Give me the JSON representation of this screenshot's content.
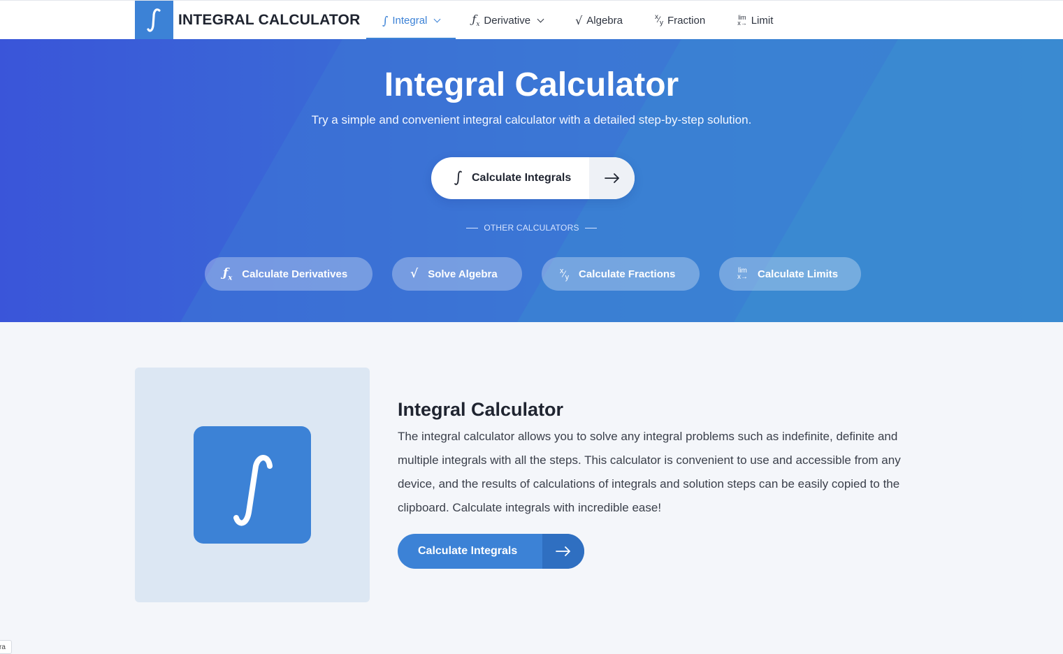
{
  "header": {
    "logo_text": "INTEGRAL CALCULATOR",
    "nav": [
      {
        "label": "Integral",
        "icon": "integral-icon",
        "glyph": "∫",
        "active": true,
        "dropdown": true
      },
      {
        "label": "Derivative",
        "icon": "function-icon",
        "glyph": "ƒ",
        "active": false,
        "dropdown": true
      },
      {
        "label": "Algebra",
        "icon": "sqrt-icon",
        "glyph": "√",
        "active": false,
        "dropdown": false
      },
      {
        "label": "Fraction",
        "icon": "fraction-icon",
        "glyph": "x⁄y",
        "active": false,
        "dropdown": false
      },
      {
        "label": "Limit",
        "icon": "limit-icon",
        "glyph": "lim",
        "active": false,
        "dropdown": false
      }
    ]
  },
  "hero": {
    "title": "Integral Calculator",
    "subtitle": "Try a simple and convenient integral calculator with a detailed step-by-step solution.",
    "cta_label": "Calculate Integrals",
    "other_label": "OTHER CALCULATORS",
    "pills": [
      {
        "label": "Calculate Derivatives",
        "icon": "function-icon"
      },
      {
        "label": "Solve Algebra",
        "icon": "sqrt-icon"
      },
      {
        "label": "Calculate Fractions",
        "icon": "fraction-icon"
      },
      {
        "label": "Calculate Limits",
        "icon": "limit-icon"
      }
    ]
  },
  "section": {
    "title": "Integral Calculator",
    "description": "The integral calculator allows you to solve any integral problems such as indefinite, definite and multiple integrals with all the steps. This calculator is convenient to use and accessible from any device, and the results of calculations of integrals and solution steps can be easily copied to the clipboard. Calculate integrals with incredible ease!",
    "cta_label": "Calculate Integrals"
  },
  "corner_tab_text": "ra",
  "colors": {
    "brand": "#3c82d6",
    "hero_left": "#3a55d9",
    "hero_right": "#3a8ad0",
    "card_bg": "#dce7f3"
  }
}
